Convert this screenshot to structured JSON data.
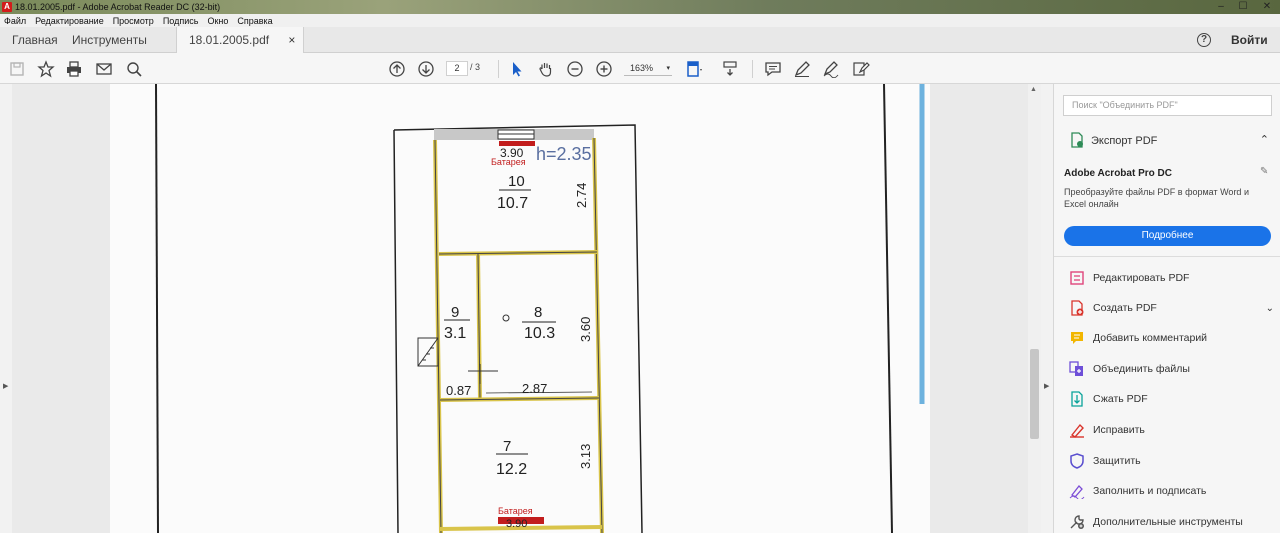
{
  "window": {
    "title": "18.01.2005.pdf - Adobe Acrobat Reader DC (32-bit)",
    "controls": [
      "–",
      "☐",
      "✕"
    ]
  },
  "menu": [
    "Файл",
    "Редактирование",
    "Просмотр",
    "Подпись",
    "Окно",
    "Справка"
  ],
  "tabs": {
    "home": "Главная",
    "tools": "Инструменты",
    "document": "18.01.2005.pdf",
    "close": "×",
    "signin": "Войти",
    "help": "?"
  },
  "toolbar": {
    "page_current": "2",
    "page_total": "/ 3",
    "zoom": "163%",
    "zoom_caret": "▾"
  },
  "floorplan": {
    "height_label": "h=2.35",
    "battery_top": "Батарея",
    "battery_bottom": "Батарея",
    "top_width": "3.90",
    "bottom_width": "3.90",
    "rooms": [
      {
        "num": "10",
        "area": "10.7"
      },
      {
        "num": "9",
        "area": "3.1"
      },
      {
        "num": "8",
        "area": "10.3"
      },
      {
        "num": "7",
        "area": "12.2"
      }
    ],
    "dims": {
      "room10_height": "2.74",
      "room8_height": "3.60",
      "room7_height": "3.13",
      "room9_width": "0.87",
      "room8_width": "2.87"
    }
  },
  "right_pane": {
    "search_placeholder": "Поиск \"Объединить PDF\"",
    "export_pdf": "Экспорт PDF",
    "promo_title": "Adobe Acrobat Pro DC",
    "promo_text": "Преобразуйте файлы PDF в формат Word и Excel онлайн",
    "promo_button": "Подробнее",
    "tools": [
      {
        "label": "Редактировать PDF",
        "icon": "edit-pdf-icon",
        "color": "#e0457b"
      },
      {
        "label": "Создать PDF",
        "icon": "create-pdf-icon",
        "color": "#d9342b"
      },
      {
        "label": "Добавить комментарий",
        "icon": "comment-icon",
        "color": "#f2b600"
      },
      {
        "label": "Объединить файлы",
        "icon": "combine-files-icon",
        "color": "#6e4fd8"
      },
      {
        "label": "Сжать PDF",
        "icon": "compress-pdf-icon",
        "color": "#0aa39a"
      },
      {
        "label": "Исправить",
        "icon": "redact-icon",
        "color": "#d9342b"
      },
      {
        "label": "Защитить",
        "icon": "protect-icon",
        "color": "#5a4fcf"
      },
      {
        "label": "Заполнить и подписать",
        "icon": "fill-sign-icon",
        "color": "#7c4dd6"
      },
      {
        "label": "Дополнительные инструменты",
        "icon": "more-tools-icon",
        "color": "#555555"
      }
    ]
  }
}
